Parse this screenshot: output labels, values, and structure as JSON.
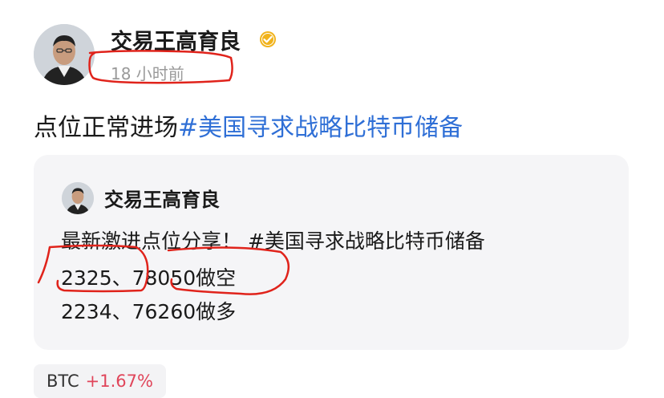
{
  "post": {
    "author": "交易王高育良",
    "time": "18 小时前",
    "text": "点位正常进场",
    "hashtag": "#美国寻求战略比特币储备"
  },
  "quote": {
    "author": "交易王高育良",
    "line1": "最新激进点位分享！ #美国寻求战略比特币储备",
    "line2": "2325、78050做空",
    "line3": "2234、76260做多"
  },
  "ticker": {
    "symbol": "BTC",
    "change": "+1.67%"
  },
  "colors": {
    "hashtag": "#2f6fd6",
    "change_up": "#e0455a",
    "annotation": "#e0231b",
    "verified_badge": "#f1b31c"
  }
}
